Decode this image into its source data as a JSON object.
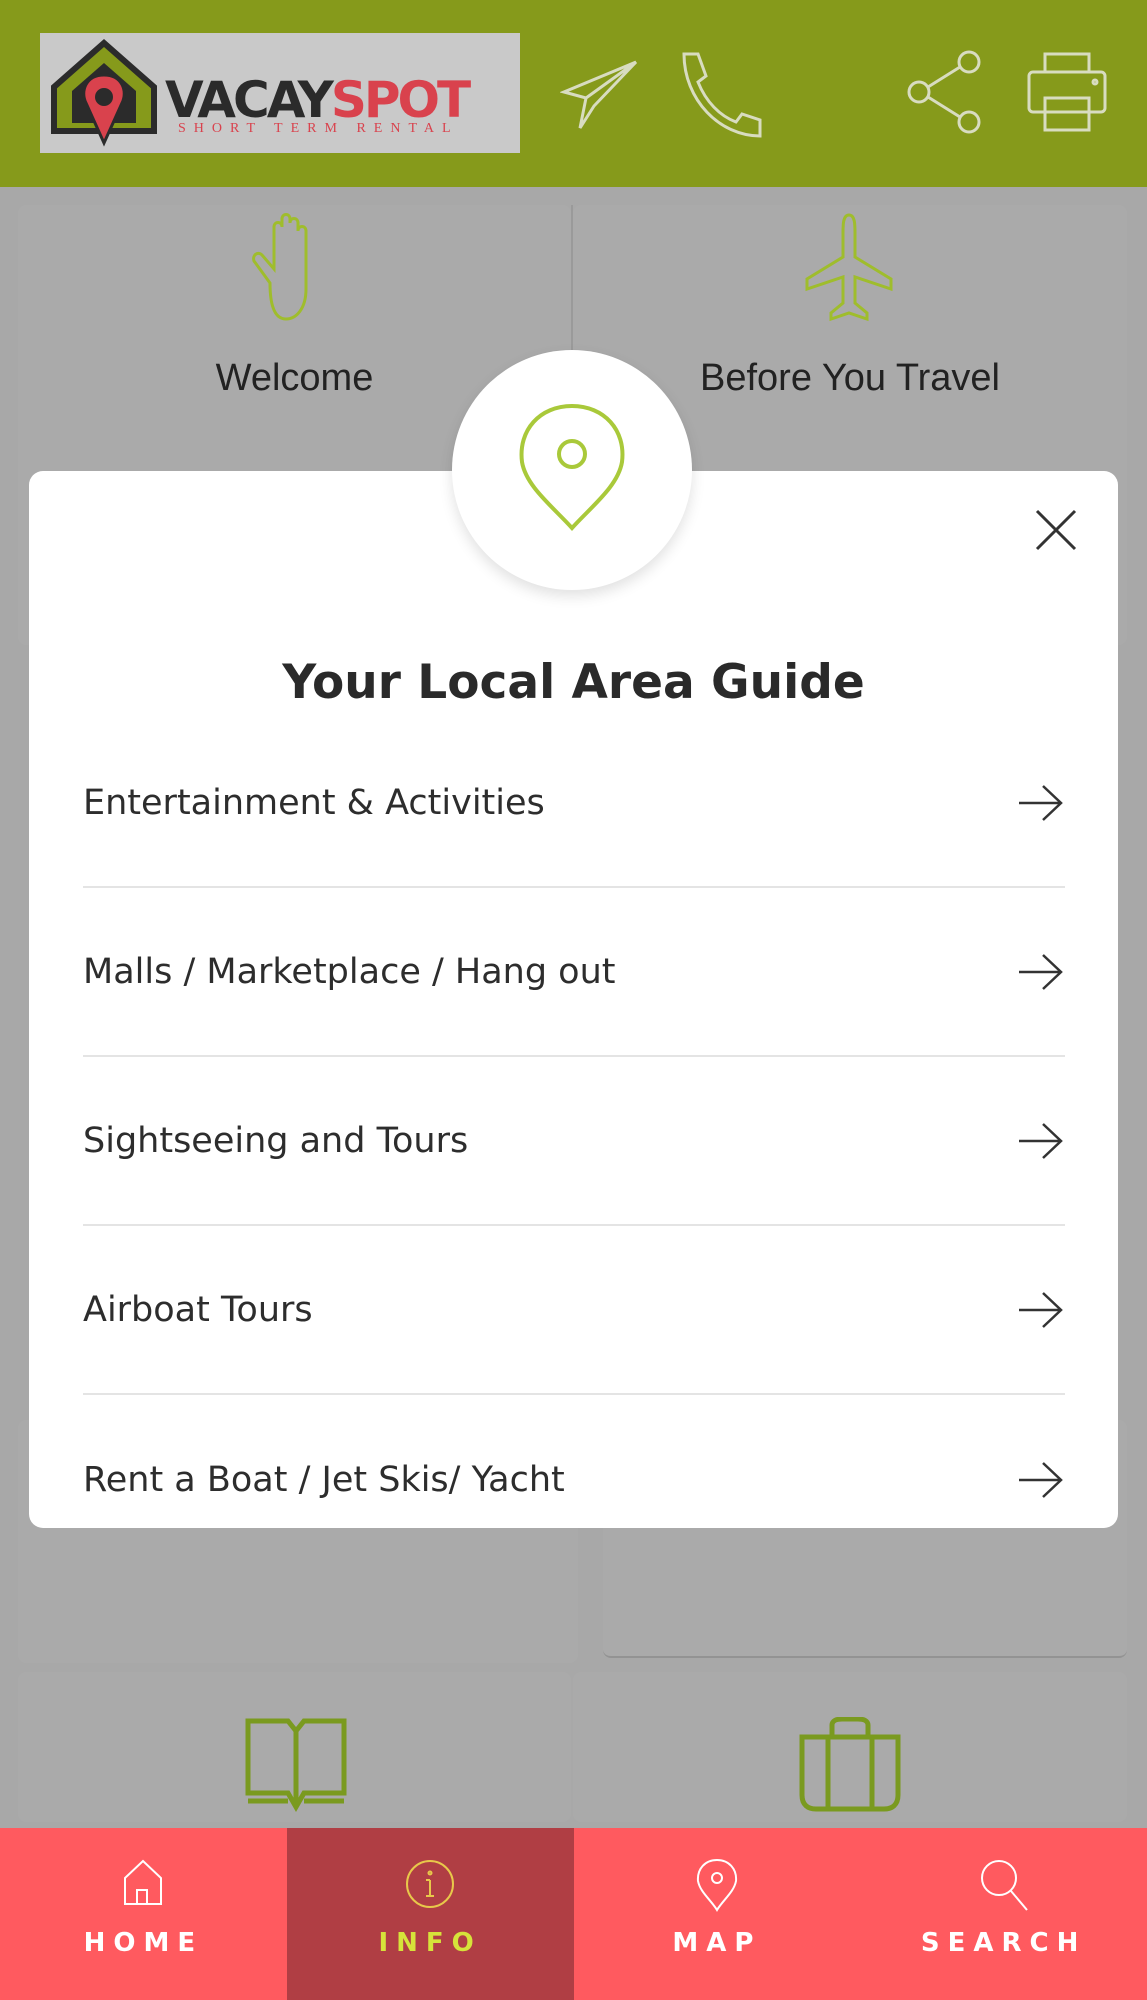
{
  "header": {
    "logo": {
      "word1": "VACAY",
      "word2": "SPOT",
      "tagline": "SHORT TERM RENTAL"
    },
    "icons": [
      "paper-plane-icon",
      "phone-icon",
      "share-icon",
      "printer-icon"
    ]
  },
  "background_cards": [
    {
      "label": "Welcome",
      "icon": "hand-icon"
    },
    {
      "label": "Before You Travel",
      "icon": "airplane-icon"
    },
    {
      "label": "",
      "icon": "book-icon"
    },
    {
      "label": "",
      "icon": "suitcase-icon"
    }
  ],
  "modal": {
    "icon": "map-pin-icon",
    "title": "Your Local Area Guide",
    "items": [
      {
        "label": "Entertainment & Activities"
      },
      {
        "label": "Malls / Marketplace / Hang out"
      },
      {
        "label": "Sightseeing and Tours"
      },
      {
        "label": "Airboat Tours"
      },
      {
        "label": "Rent a Boat / Jet Skis/ Yacht"
      }
    ]
  },
  "nav": {
    "items": [
      {
        "label": "HOME",
        "icon": "home-icon"
      },
      {
        "label": "INFO",
        "icon": "info-icon",
        "active": true
      },
      {
        "label": "MAP",
        "icon": "map-pin-icon"
      },
      {
        "label": "SEARCH",
        "icon": "search-icon"
      }
    ]
  },
  "colors": {
    "header": "#869a1b",
    "accent_green": "#a9c93a",
    "nav": "#ff5a5f",
    "nav_active": "#b03e44",
    "brand_red": "#d9424d"
  }
}
